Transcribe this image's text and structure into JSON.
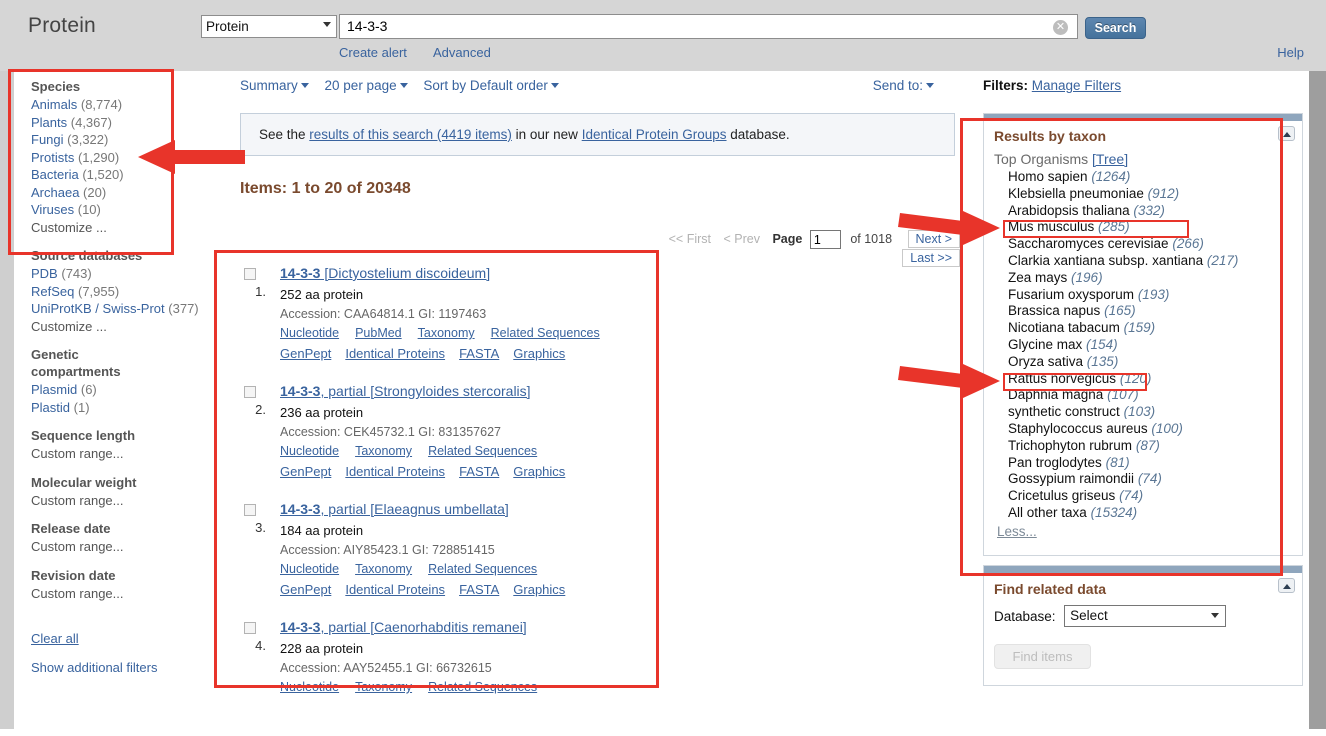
{
  "header": {
    "db_title": "Protein",
    "db_select_value": "Protein",
    "search_value": "14-3-3",
    "search_placeholder": "",
    "search_button": "Search",
    "create_alert": "Create alert",
    "advanced": "Advanced",
    "help": "Help",
    "clear_icon": "clear-circle-icon"
  },
  "facets": [
    {
      "heading": "Species",
      "items": [
        {
          "label": "Animals",
          "count": "(8,774)"
        },
        {
          "label": "Plants",
          "count": "(4,367)"
        },
        {
          "label": "Fungi",
          "count": "(3,322)"
        },
        {
          "label": "Protists",
          "count": "(1,290)"
        },
        {
          "label": "Bacteria",
          "count": "(1,520)"
        },
        {
          "label": "Archaea",
          "count": "(20)"
        },
        {
          "label": "Viruses",
          "count": "(10)"
        },
        {
          "label": "Customize ...",
          "count": ""
        }
      ]
    },
    {
      "heading": "Source databases",
      "items": [
        {
          "label": "PDB",
          "count": "(743)"
        },
        {
          "label": "RefSeq",
          "count": "(7,955)"
        },
        {
          "label": "UniProtKB / Swiss-Prot",
          "count": "(377)"
        },
        {
          "label": "Customize ...",
          "count": ""
        }
      ]
    },
    {
      "heading": "Genetic compartments",
      "items": [
        {
          "label": "Plasmid",
          "count": "(6)"
        },
        {
          "label": "Plastid",
          "count": "(1)"
        }
      ]
    },
    {
      "heading": "Sequence length",
      "items": [
        {
          "label": "Custom range...",
          "count": ""
        }
      ]
    },
    {
      "heading": "Molecular weight",
      "items": [
        {
          "label": "Custom range...",
          "count": ""
        }
      ]
    },
    {
      "heading": "Release date",
      "items": [
        {
          "label": "Custom range...",
          "count": ""
        }
      ]
    },
    {
      "heading": "Revision date",
      "items": [
        {
          "label": "Custom range...",
          "count": ""
        }
      ]
    }
  ],
  "facet_footer": {
    "clear_all": "Clear all",
    "show_additional": "Show additional filters"
  },
  "display_bar": {
    "format": "Summary",
    "per_page": "20 per page",
    "sort": "Sort by Default order",
    "send_to": "Send to:"
  },
  "ipg_note": {
    "pre": "See the ",
    "link1": "results of this search (4419 items)",
    "mid": " in our new ",
    "link2": "Identical Protein Groups",
    "post": " database."
  },
  "items_count": "Items: 1 to 20 of 20348",
  "pager": {
    "first": "<< First",
    "prev": "< Prev",
    "page_label": "Page",
    "page_value": "1",
    "of": "of 1018",
    "next": "Next >",
    "last": "Last >>"
  },
  "results": [
    {
      "num": "1.",
      "title_q": "14-3-3",
      "title_rest": " [Dictyostelium discoideum]",
      "length": "252 aa protein",
      "accession": "Accession: CAA64814.1  GI: 1197463",
      "links_row1": [
        "Nucleotide",
        "PubMed",
        "Taxonomy",
        "Related Sequences"
      ],
      "links_row2": [
        "GenPept",
        "Identical Proteins",
        "FASTA",
        "Graphics"
      ]
    },
    {
      "num": "2.",
      "title_q": "14-3-3",
      "title_rest": ", partial [Strongyloides stercoralis]",
      "length": "236 aa protein",
      "accession": "Accession: CEK45732.1  GI: 831357627",
      "links_row1": [
        "Nucleotide",
        "Taxonomy",
        "Related Sequences"
      ],
      "links_row2": [
        "GenPept",
        "Identical Proteins",
        "FASTA",
        "Graphics"
      ]
    },
    {
      "num": "3.",
      "title_q": "14-3-3",
      "title_rest": ", partial [Elaeagnus umbellata]",
      "length": "184 aa protein",
      "accession": "Accession: AIY85423.1  GI: 728851415",
      "links_row1": [
        "Nucleotide",
        "Taxonomy",
        "Related Sequences"
      ],
      "links_row2": [
        "GenPept",
        "Identical Proteins",
        "FASTA",
        "Graphics"
      ]
    },
    {
      "num": "4.",
      "title_q": "14-3-3",
      "title_rest": ", partial [Caenorhabditis remanei]",
      "length": "228 aa protein",
      "accession": "Accession: AAY52455.1  GI: 66732615",
      "links_row1": [
        "Nucleotide",
        "Taxonomy",
        "Related Sequences"
      ],
      "links_row2": []
    }
  ],
  "right": {
    "filters_label": "Filters:",
    "manage_filters": "Manage Filters",
    "taxon_panel": {
      "title": "Results by taxon",
      "top_organisms": "Top Organisms",
      "tree_link": "[Tree]",
      "less": "Less...",
      "collapse_icon": "collapse-triangle-icon",
      "organisms": [
        {
          "name": "Homo sapien",
          "count": "(1264)"
        },
        {
          "name": "Klebsiella pneumoniae",
          "count": "(912)"
        },
        {
          "name": "Arabidopsis thaliana",
          "count": "(332)"
        },
        {
          "name": "Mus musculus",
          "count": "(285)"
        },
        {
          "name": "Saccharomyces cerevisiae",
          "count": "(266)"
        },
        {
          "name": "Clarkia xantiana subsp. xantiana",
          "count": "(217)"
        },
        {
          "name": "Zea mays",
          "count": "(196)"
        },
        {
          "name": "Fusarium oxysporum",
          "count": "(193)"
        },
        {
          "name": "Brassica napus",
          "count": "(165)"
        },
        {
          "name": "Nicotiana tabacum",
          "count": "(159)"
        },
        {
          "name": "Glycine max",
          "count": "(154)"
        },
        {
          "name": "Oryza sativa",
          "count": "(135)"
        },
        {
          "name": "Rattus norvegicus",
          "count": "(120)"
        },
        {
          "name": "Daphnia magna",
          "count": "(107)"
        },
        {
          "name": "synthetic construct",
          "count": "(103)"
        },
        {
          "name": "Staphylococcus aureus",
          "count": "(100)"
        },
        {
          "name": "Trichophyton rubrum",
          "count": "(87)"
        },
        {
          "name": "Pan troglodytes",
          "count": "(81)"
        },
        {
          "name": "Gossypium raimondii",
          "count": "(74)"
        },
        {
          "name": "Cricetulus griseus",
          "count": "(74)"
        },
        {
          "name": "All other taxa",
          "count": "(15324)"
        }
      ]
    },
    "find_related": {
      "title": "Find related data",
      "database_label": "Database:",
      "database_value": "Select",
      "find_items": "Find items",
      "collapse_icon": "collapse-triangle-icon"
    }
  },
  "annotation": {
    "color": "#e8342a",
    "boxes": [
      "species-facet-box",
      "results-list-box",
      "taxon-panel-box",
      "arabidopsis-thaliana-box",
      "oryza-sativa-box"
    ],
    "arrows": [
      "arrow-to-plants",
      "arrow-to-arabidopsis",
      "arrow-to-oryza"
    ]
  }
}
